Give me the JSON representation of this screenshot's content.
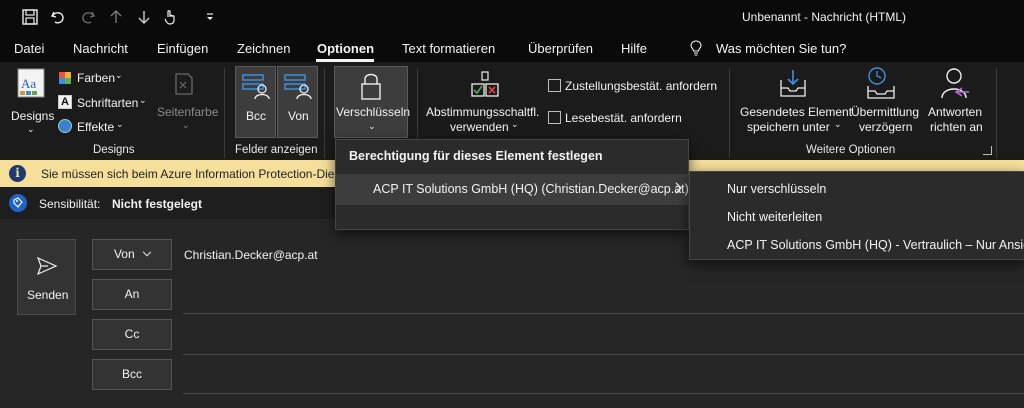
{
  "window": {
    "title": "Unbenannt  -  Nachricht (HTML)"
  },
  "tabs": [
    "Datei",
    "Nachricht",
    "Einfügen",
    "Zeichnen",
    "Optionen",
    "Text formatieren",
    "Überprüfen",
    "Hilfe"
  ],
  "active_tab": "Optionen",
  "tell_me": "Was möchten Sie tun?",
  "ribbon": {
    "designs": {
      "designs_label": "Designs",
      "farben": "Farben",
      "schriftarten": "Schriftarten",
      "effekte": "Effekte",
      "seitenfarbe": "Seitenfarbe",
      "group_label": "Designs"
    },
    "felder": {
      "bcc": "Bcc",
      "von": "Von",
      "group_label": "Felder anzeigen"
    },
    "verschluesseln": {
      "label": "Verschlüsseln"
    },
    "abstimmung": {
      "line1": "Abstimmungsschaltfl.",
      "line2": "verwenden"
    },
    "zustellung": "Zustellungsbestät. anfordern",
    "lese": "Lesebestät. anfordern",
    "weitere": {
      "gesendetes_line1": "Gesendetes Element",
      "gesendetes_line2": "speichern unter",
      "uebermittlung_line1": "Übermittlung",
      "uebermittlung_line2": "verzögern",
      "antworten_line1": "Antworten",
      "antworten_line2": "richten an",
      "group_label": "Weitere Optionen"
    }
  },
  "infobar": {
    "text": "Sie müssen sich beim Azure Information Protection-Dienst anmelden"
  },
  "sensitivity": {
    "label": "Sensibilität:",
    "value": "Nicht festgelegt"
  },
  "compose": {
    "send": "Senden",
    "von": "Von",
    "von_value": "Christian.Decker@acp.at",
    "an": "An",
    "cc": "Cc",
    "bcc": "Bcc"
  },
  "menu": {
    "header": "Berechtigung für dieses Element festlegen",
    "item": "ACP IT Solutions GmbH (HQ) (Christian.Decker@acp.at)"
  },
  "submenu": {
    "items": [
      "Nur verschlüsseln",
      "Nicht weiterleiten",
      "ACP IT Solutions GmbH (HQ) - Vertraulich – Nur Ansicht"
    ]
  },
  "colors": {
    "accent": "#1f64c4",
    "infobar": "#f5df9a",
    "ribbon": "#1b1b1b",
    "titlebar": "#0a0a0a"
  }
}
